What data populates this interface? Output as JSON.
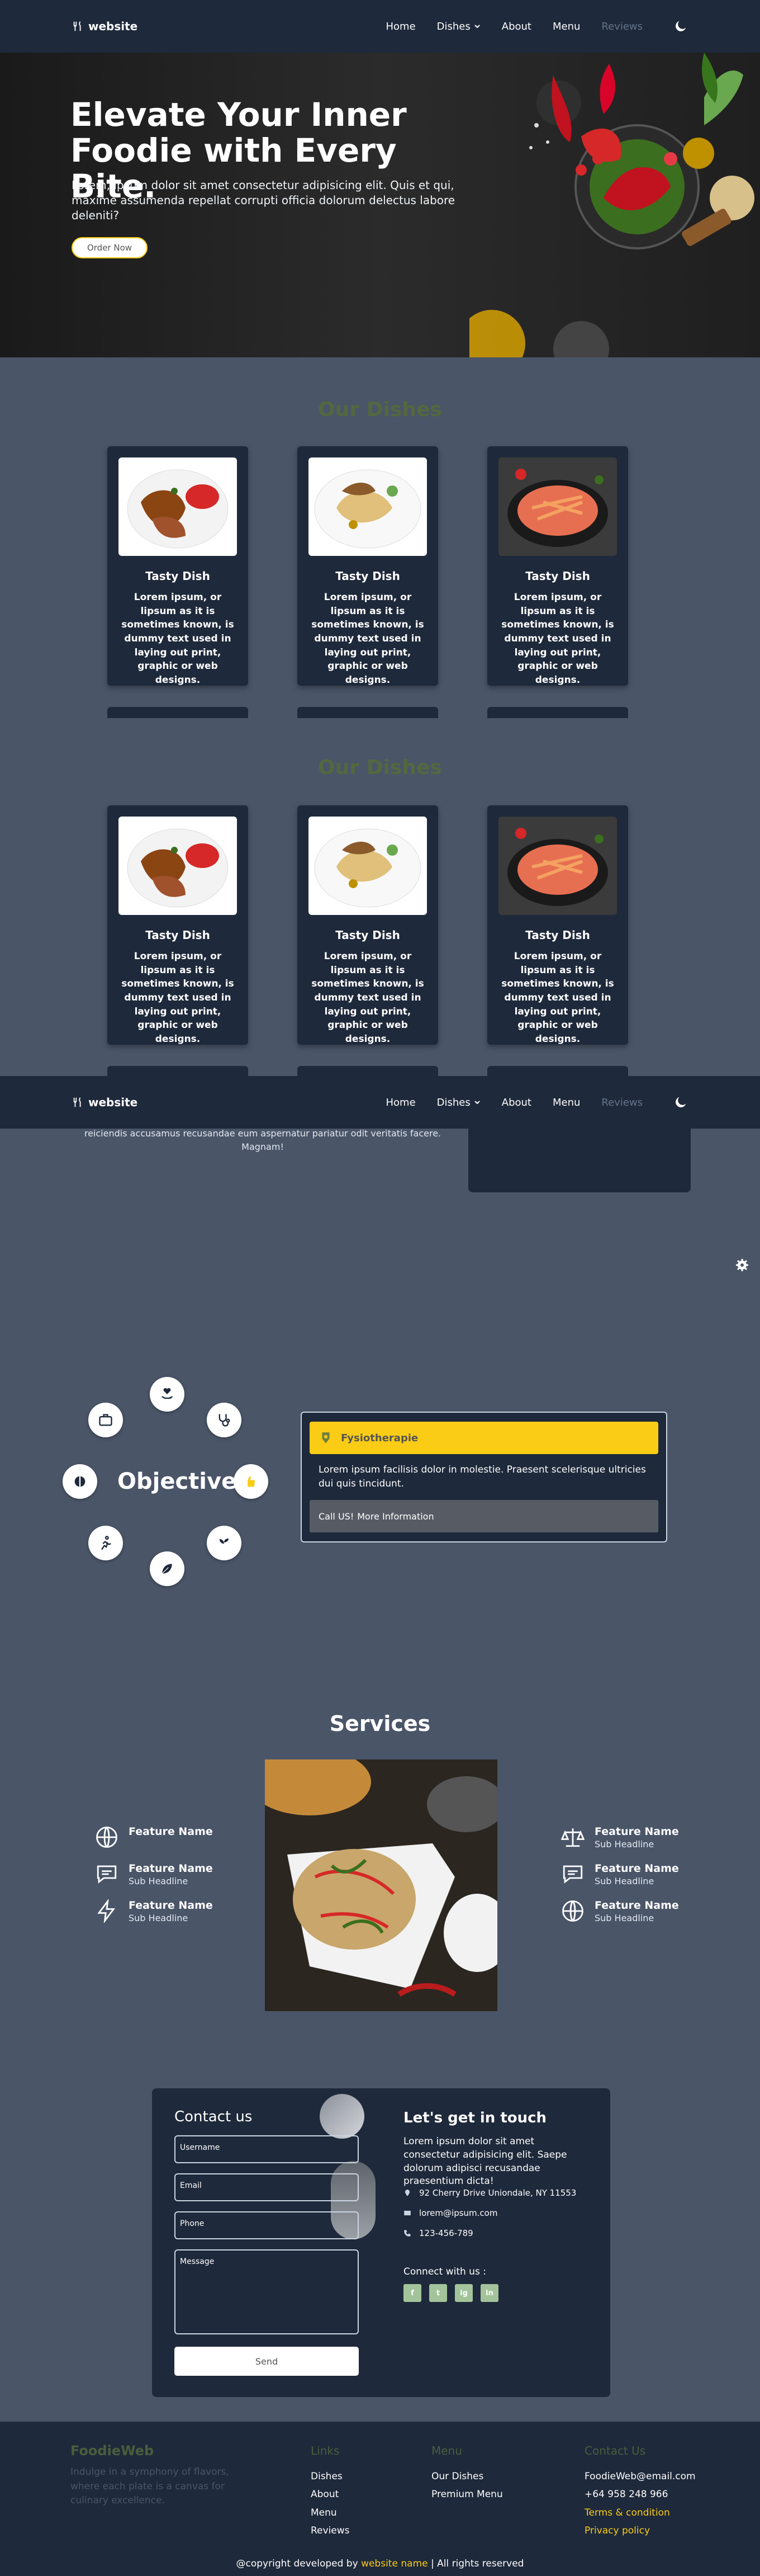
{
  "nav": {
    "brand": "website",
    "items": [
      "Home",
      "Dishes",
      "About",
      "Menu",
      "Reviews"
    ]
  },
  "hero": {
    "title": "Elevate Your Inner Foodie with Every Bite.",
    "text": "Lorem, ipsum dolor sit amet consectetur adipisicing elit. Quis et qui, maxime assumenda repellat corrupti officia dolorum delectus labore deleniti?",
    "button": "Order Now"
  },
  "dishes": {
    "title": "Our Dishes",
    "cards": [
      {
        "title": "Tasty Dish",
        "text": "Lorem ipsum, or lipsum as it is sometimes known, is dummy text used in laying out print, graphic or web designs."
      },
      {
        "title": "Tasty Dish",
        "text": "Lorem ipsum, or lipsum as it is sometimes known, is dummy text used in laying out print, graphic or web designs."
      },
      {
        "title": "Tasty Dish",
        "text": "Lorem ipsum, or lipsum as it is sometimes known, is dummy text used in laying out print, graphic or web designs."
      }
    ]
  },
  "mid": {
    "text": "reiciendis accusamus recusandae eum aspernatur pariatur odit veritatis facere. Magnam!"
  },
  "objective": {
    "title": "Objective",
    "panel_title": "Fysiotherapie",
    "panel_text": "Lorem ipsum facilisis dolor in molestie. Praesent scelerisque ultricies dui quis tincidunt.",
    "panel_footer_prefix": "Call US!",
    "panel_footer_link": "More Information"
  },
  "services": {
    "title": "Services",
    "left": [
      {
        "name": "Feature Name",
        "sub": ""
      },
      {
        "name": "Feature Name",
        "sub": "Sub Headline"
      },
      {
        "name": "Feature Name",
        "sub": "Sub Headline"
      }
    ],
    "right": [
      {
        "name": "Feature Name",
        "sub": "Sub Headline"
      },
      {
        "name": "Feature Name",
        "sub": "Sub Headline"
      },
      {
        "name": "Feature Name",
        "sub": "Sub Headline"
      }
    ]
  },
  "contact": {
    "title": "Contact us",
    "username_ph": "Username",
    "email_ph": "Email",
    "phone_ph": "Phone",
    "message_ph": "Message",
    "send": "Send",
    "info_title": "Let's get in touch",
    "info_text": "Lorem ipsum dolor sit amet consectetur adipisicing elit. Saepe dolorum adipisci recusandae praesentium dicta!",
    "address": "92 Cherry Drive Uniondale, NY 11553",
    "email": "lorem@ipsum.com",
    "phone": "123-456-789",
    "connect": "Connect with us :",
    "socials": [
      "f",
      "t",
      "ig",
      "in"
    ]
  },
  "footer": {
    "brand": "FoodieWeb",
    "desc": "Indulge in a symphony of flavors, where each plate is a canvas for culinary excellence.",
    "links_title": "Links",
    "links": [
      "Dishes",
      "About",
      "Menu",
      "Reviews"
    ],
    "menu_title": "Menu",
    "menu": [
      "Our Dishes",
      "Premium Menu"
    ],
    "contact_title": "Contact Us",
    "contact_email": "FoodieWeb@email.com",
    "contact_phone": "+64 958 248 966",
    "terms": "Terms & condition",
    "privacy": "Privacy policy",
    "copy_prefix": "@copyright developed by",
    "copy_link": "website name",
    "copy_suffix": "| All rights reserved"
  }
}
